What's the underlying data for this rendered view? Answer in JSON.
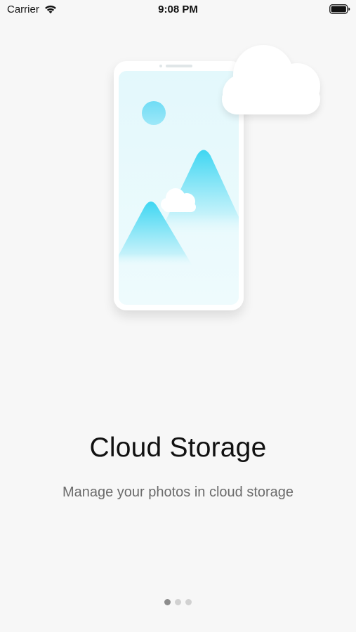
{
  "status_bar": {
    "carrier": "Carrier",
    "time": "9:08 PM",
    "wifi_icon": "wifi-icon",
    "battery_icon": "battery-icon"
  },
  "onboarding": {
    "title": "Cloud Storage",
    "subtitle": "Manage your photos in cloud storage",
    "page_count": 3,
    "current_page": 1
  },
  "colors": {
    "background": "#f7f7f7",
    "accent": "#4fd3f0",
    "dot_active": "#8c8c8c",
    "dot_inactive": "#d1d1d1"
  }
}
